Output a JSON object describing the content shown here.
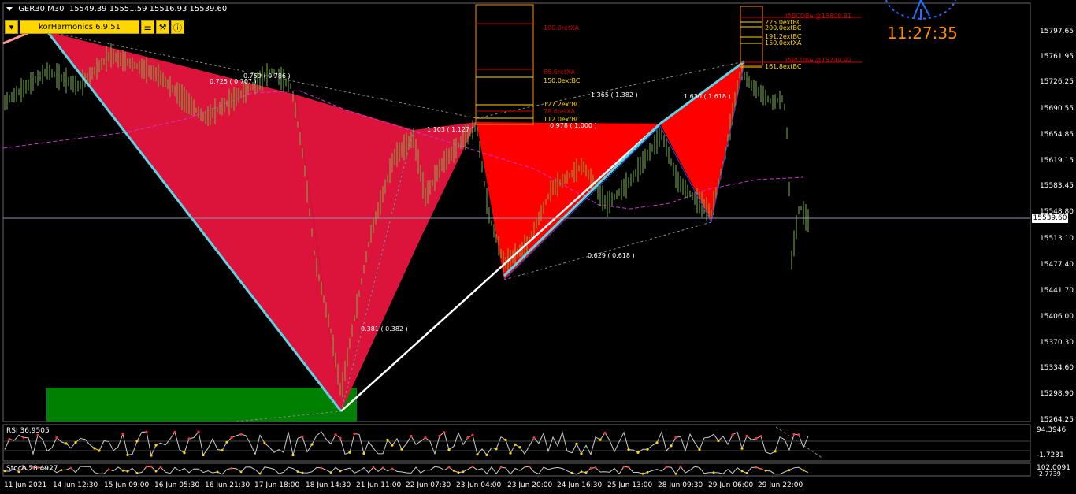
{
  "header": {
    "symbol_tf": "GER30,M30",
    "ohlc": "15549.39 15551.59 15516.93 15539.60"
  },
  "toolbar": {
    "dropdown_icon": "chevron-down-icon",
    "label": "korHarmonics 6.9.51",
    "icons": [
      "sliders-icon",
      "tools-icon",
      "info-icon"
    ],
    "glyphs": [
      "⚌",
      "⚒",
      "ⓘ"
    ]
  },
  "clock": "11:27:35",
  "price_axis": {
    "labels": [
      "15797.65",
      "15761.95",
      "15726.25",
      "15690.55",
      "15654.85",
      "15619.15",
      "15583.45",
      "15548.80",
      "15513.10",
      "15477.40",
      "15441.70",
      "15406.00",
      "15370.30",
      "15334.60",
      "15298.90",
      "15264.25"
    ],
    "current_price": "15539.60"
  },
  "time_axis": {
    "labels": [
      "11 Jun 2021",
      "14 Jun 12:30",
      "15 Jun 09:00",
      "16 Jun 05:30",
      "16 Jun 21:30",
      "17 Jun 18:00",
      "18 Jun 14:30",
      "21 Jun 11:00",
      "22 Jun 07:30",
      "23 Jun 04:00",
      "23 Jun 20:00",
      "24 Jun 16:30",
      "25 Jun 13:00",
      "28 Jun 09:30",
      "29 Jun 06:00",
      "29 Jun 22:00"
    ]
  },
  "ratios": {
    "r1": "0.725 ( 0.707 )",
    "r2": "0.759 ( 0.786 )",
    "r3": "1.103 ( 1.127 )",
    "r4": "0.381 ( 0.382 )",
    "r5": "0.978 ( 1.000 )",
    "r6": "1.365 ( 1.382 )",
    "r7": "1.630 ( 1.618 )",
    "r8": "0.629 ( 0.618 )"
  },
  "levels_left": {
    "l1": "100.0retXA",
    "l2": "88.6retXA",
    "l3": "150.0extBC",
    "l4": "127.2extBC",
    "l5": "78.6retXA",
    "l6": "112.0extBC"
  },
  "levels_right": {
    "m1": "IABCDBe   @15808.81",
    "m2": "225.0extBC",
    "m3": "200.0extBC",
    "m4": "191.2extBC",
    "m5": "150.0extXA",
    "m6": "IABCDBe   @15749.92",
    "m7": "161.8extBC"
  },
  "rsi": {
    "label": "RSI 36.9505",
    "max": "94.3946",
    "min": "-1.7231",
    "mid": "50"
  },
  "stoch": {
    "label": "Stoch 58.4927",
    "max": "102.0091",
    "min": "-2.7739"
  },
  "colors": {
    "bg": "#000000",
    "candle": "#7cb342",
    "pattern_left": "#dc143c",
    "pattern_right": "#ff0000",
    "leg_cyan": "#5ad6e6",
    "leg_white": "#ffffff",
    "ma": "#cc33cc",
    "clock": "#ff8c00",
    "zone_green": "#008000",
    "gold": "#ffd700"
  }
}
